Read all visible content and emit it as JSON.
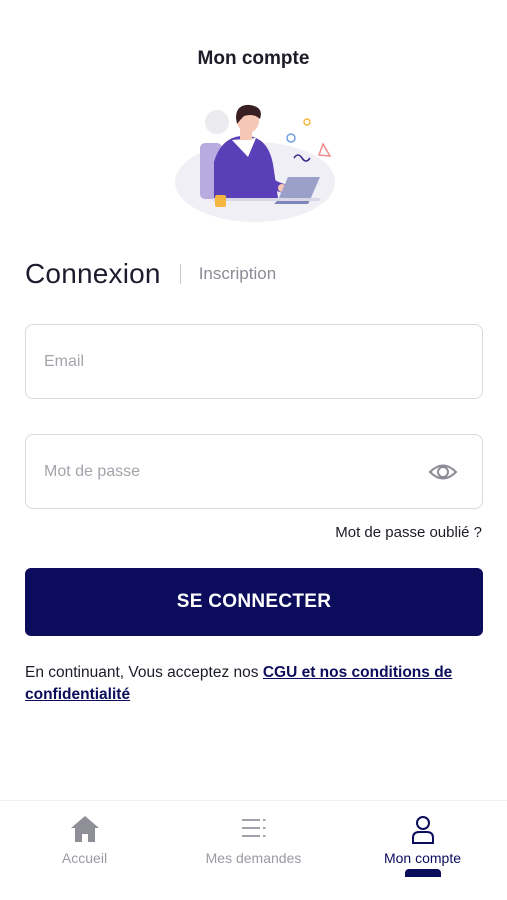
{
  "header": {
    "title": "Mon compte"
  },
  "auth": {
    "active_tab": "Connexion",
    "inactive_tab": "Inscription"
  },
  "form": {
    "email_placeholder": "Email",
    "email_value": "",
    "password_placeholder": "Mot de passe",
    "password_value": "",
    "forgot_password": "Mot de passe oublié ?",
    "submit_label": "SE CONNECTER"
  },
  "terms": {
    "prefix": "En continuant, Vous acceptez nos ",
    "link": "CGU et nos conditions de confidentialité"
  },
  "tabbar": {
    "items": [
      {
        "label": "Accueil",
        "icon": "home-icon"
      },
      {
        "label": "Mes demandes",
        "icon": "list-icon"
      },
      {
        "label": "Mon compte",
        "icon": "user-icon"
      }
    ],
    "active_index": 2
  },
  "colors": {
    "primary": "#0b0d5c",
    "illustration_purple": "#5b3fb8",
    "text": "#1c1c28",
    "muted": "#9a9aa3"
  }
}
